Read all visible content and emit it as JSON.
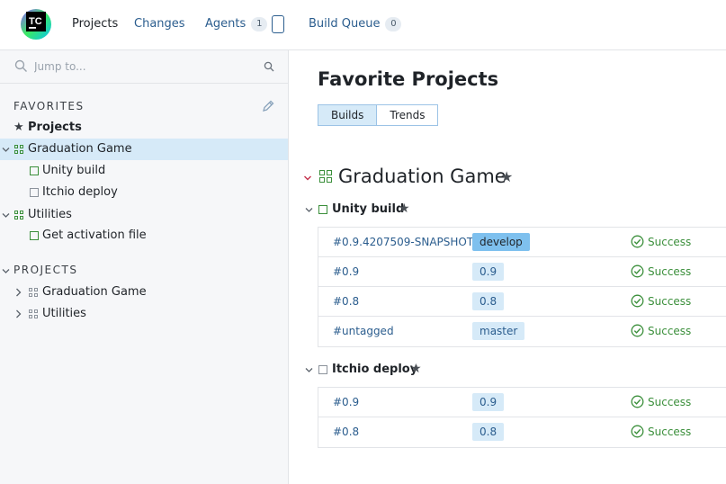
{
  "app": {
    "logo_text": "TC"
  },
  "nav": {
    "projects": "Projects",
    "changes": "Changes",
    "agents": "Agents",
    "agents_count": "1",
    "build_queue": "Build Queue",
    "build_queue_count": "0"
  },
  "search": {
    "placeholder": "Jump to..."
  },
  "sidebar": {
    "favorites_title": "FAVORITES",
    "favorites": [
      {
        "label": "Projects",
        "icon": "star-icon",
        "selected": true
      },
      {
        "label": "Graduation Game",
        "icon": "project-icon",
        "expanded": true
      },
      {
        "label": "Unity build",
        "icon": "build-config-icon"
      },
      {
        "label": "Itchio deploy",
        "icon": "build-config-icon"
      },
      {
        "label": "Utilities",
        "icon": "project-icon",
        "expanded": true
      },
      {
        "label": "Get activation file",
        "icon": "build-config-icon"
      }
    ],
    "projects_title": "PROJECTS",
    "projects": [
      {
        "label": "Graduation Game",
        "icon": "project-icon"
      },
      {
        "label": "Utilities",
        "icon": "project-icon"
      }
    ]
  },
  "main": {
    "title": "Favorite Projects",
    "tabs": [
      "Builds",
      "Trends"
    ],
    "active_tab": "Builds",
    "project": {
      "name": "Graduation Game",
      "configs": [
        {
          "name": "Unity build",
          "builds": [
            {
              "number": "#0.9.4207509-SNAPSHOT",
              "branch": "develop",
              "status": "Success"
            },
            {
              "number": "#0.9",
              "branch": "0.9",
              "status": "Success"
            },
            {
              "number": "#0.8",
              "branch": "0.8",
              "status": "Success"
            },
            {
              "number": "#untagged",
              "branch": "master",
              "status": "Success"
            }
          ]
        },
        {
          "name": "Itchio deploy",
          "builds": [
            {
              "number": "#0.9",
              "branch": "0.9",
              "status": "Success"
            },
            {
              "number": "#0.8",
              "branch": "0.8",
              "status": "Success"
            }
          ]
        }
      ]
    }
  },
  "colors": {
    "accent": "#2b5d8e",
    "success": "#3b8f3b",
    "selected_bg": "#d6eaf8",
    "sidebar_bg": "#f6f7f9"
  }
}
